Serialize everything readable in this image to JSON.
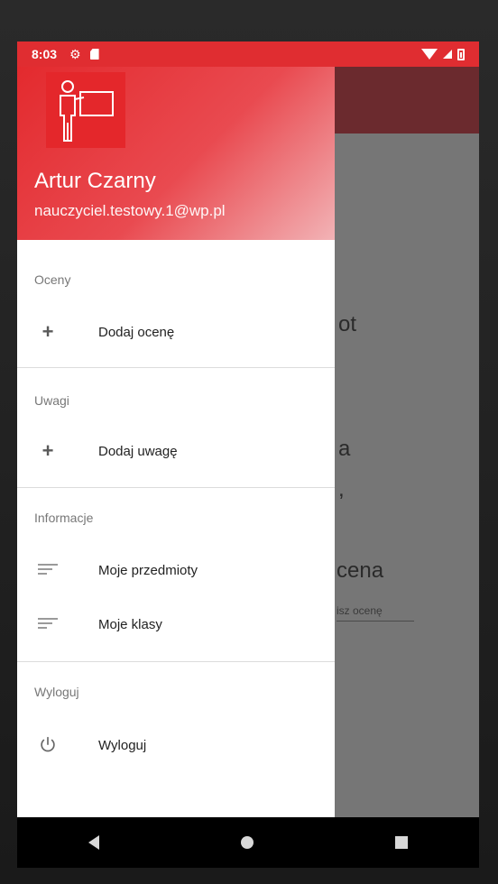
{
  "status_bar": {
    "time": "8:03"
  },
  "drawer": {
    "user_name": "Artur Czarny",
    "user_email": "nauczyciel.testowy.1@wp.pl",
    "sections": [
      {
        "label": "Oceny",
        "items": [
          {
            "label": "Dodaj ocenę",
            "icon": "plus-icon"
          }
        ]
      },
      {
        "label": "Uwagi",
        "items": [
          {
            "label": "Dodaj uwagę",
            "icon": "plus-icon"
          }
        ]
      },
      {
        "label": "Informacje",
        "items": [
          {
            "label": "Moje przedmioty",
            "icon": "lines-icon"
          },
          {
            "label": "Moje klasy",
            "icon": "lines-icon"
          }
        ]
      },
      {
        "label": "Wyloguj",
        "items": [
          {
            "label": "Wyloguj",
            "icon": "power-icon"
          }
        ]
      }
    ]
  },
  "background": {
    "text1": "ot",
    "text2": "a",
    "text3": ",",
    "text4": "cena",
    "text5": "isz ocenę"
  },
  "colors": {
    "accent": "#e02d31",
    "toolbar_dim": "#6b2a2e",
    "nav": "#000000"
  }
}
